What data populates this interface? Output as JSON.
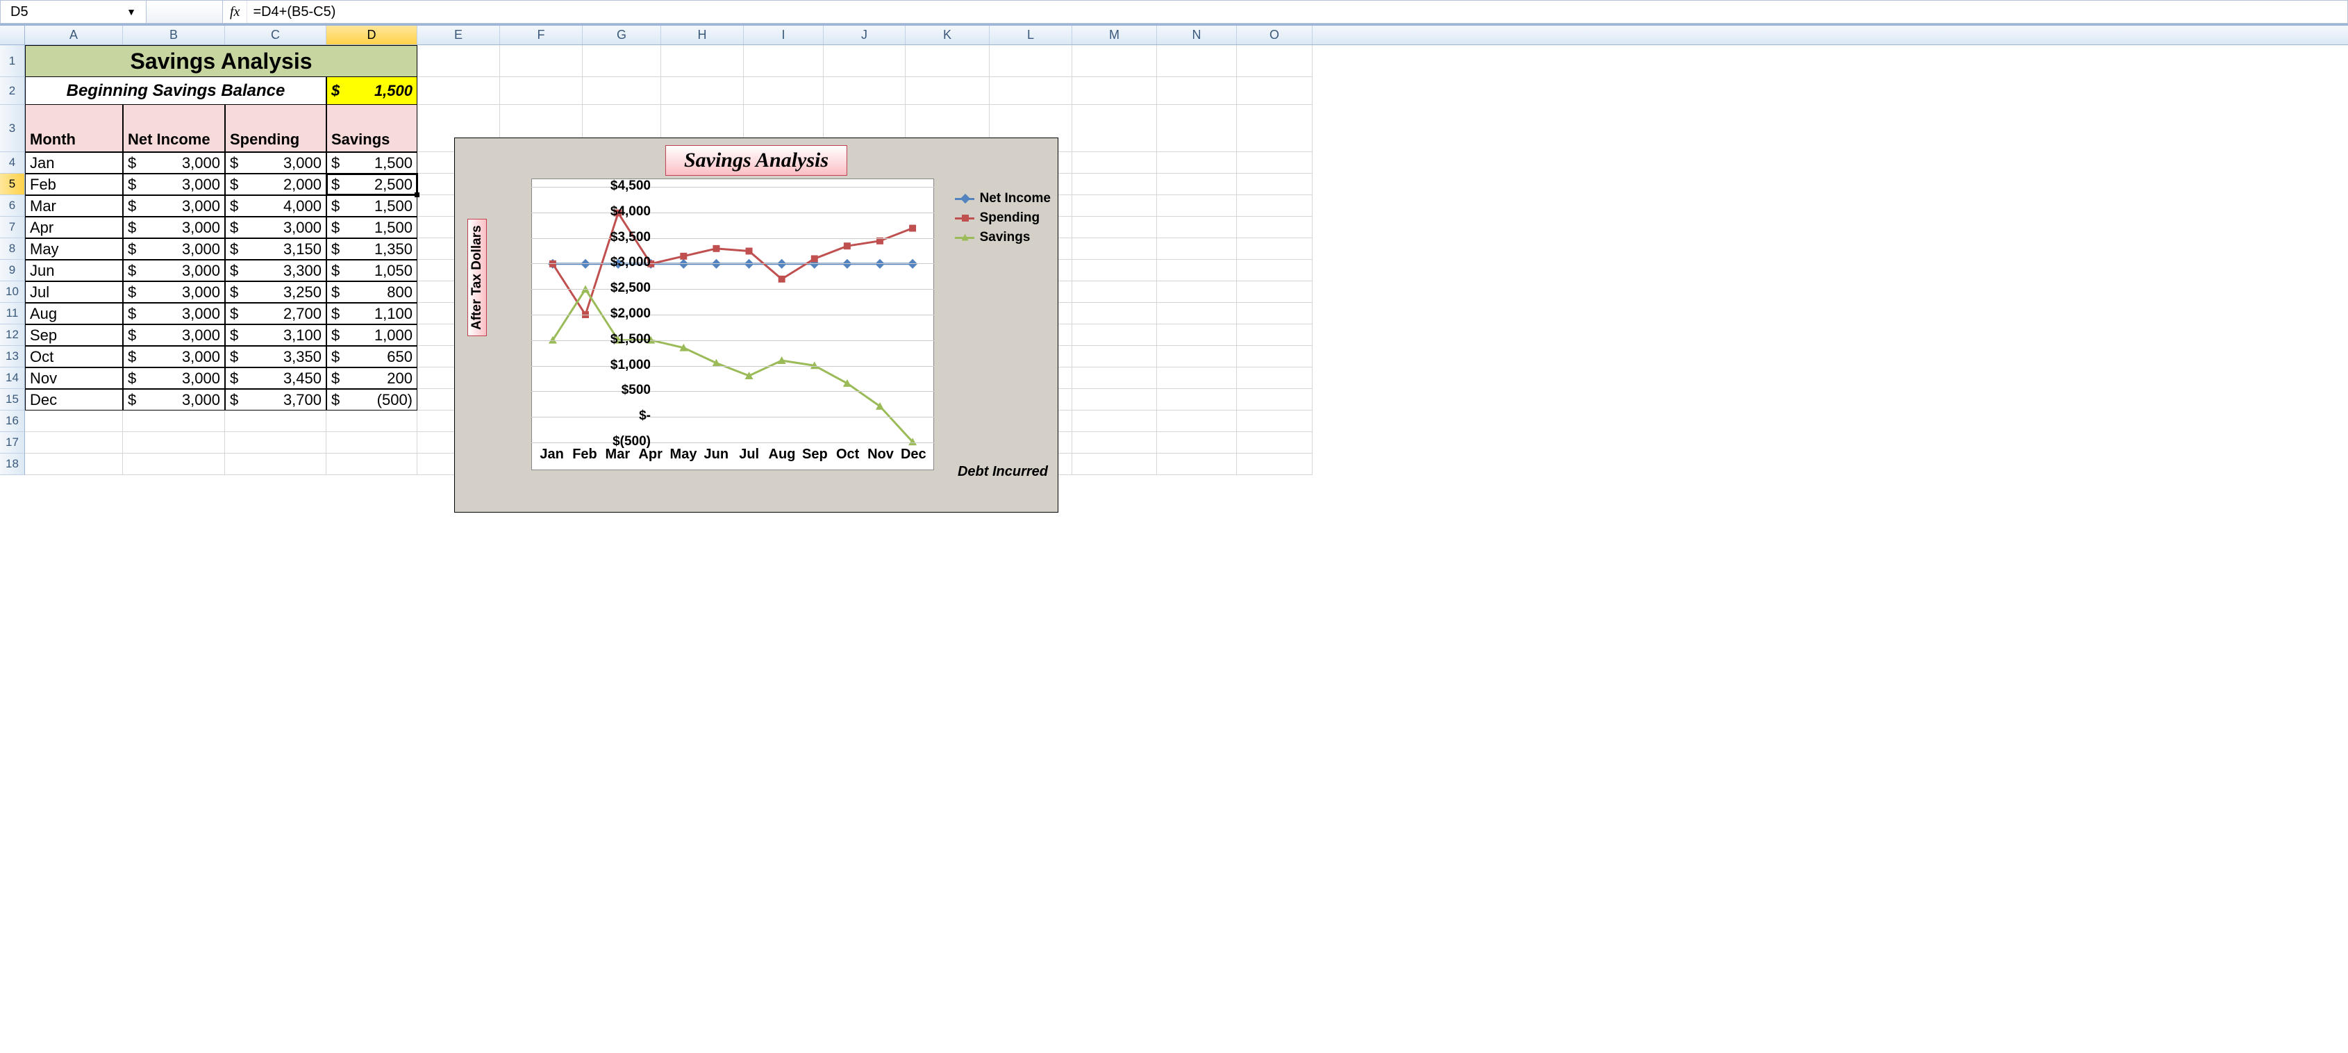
{
  "formula_bar": {
    "cell_ref": "D5",
    "fx_label": "fx",
    "formula": "=D4+(B5-C5)"
  },
  "columns": [
    "A",
    "B",
    "C",
    "D",
    "E",
    "F",
    "G",
    "H",
    "I",
    "J",
    "K",
    "L",
    "M",
    "N",
    "O"
  ],
  "selected_col": "D",
  "selected_row": "5",
  "rows": [
    "1",
    "2",
    "3",
    "4",
    "5",
    "6",
    "7",
    "8",
    "9",
    "10",
    "11",
    "12",
    "13",
    "14",
    "15",
    "16",
    "17",
    "18"
  ],
  "sheet": {
    "title": "Savings Analysis",
    "begin_label": "Beginning Savings Balance",
    "begin_value_sym": "$",
    "begin_value": "1,500",
    "headers": {
      "month": "Month",
      "income": "Net Income",
      "spending": "Spending",
      "savings": "Savings"
    },
    "data": [
      {
        "m": "Jan",
        "inc": "3,000",
        "sp": "3,000",
        "sv": "1,500"
      },
      {
        "m": "Feb",
        "inc": "3,000",
        "sp": "2,000",
        "sv": "2,500"
      },
      {
        "m": "Mar",
        "inc": "3,000",
        "sp": "4,000",
        "sv": "1,500"
      },
      {
        "m": "Apr",
        "inc": "3,000",
        "sp": "3,000",
        "sv": "1,500"
      },
      {
        "m": "May",
        "inc": "3,000",
        "sp": "3,150",
        "sv": "1,350"
      },
      {
        "m": "Jun",
        "inc": "3,000",
        "sp": "3,300",
        "sv": "1,050"
      },
      {
        "m": "Jul",
        "inc": "3,000",
        "sp": "3,250",
        "sv": "800"
      },
      {
        "m": "Aug",
        "inc": "3,000",
        "sp": "2,700",
        "sv": "1,100"
      },
      {
        "m": "Sep",
        "inc": "3,000",
        "sp": "3,100",
        "sv": "1,000"
      },
      {
        "m": "Oct",
        "inc": "3,000",
        "sp": "3,350",
        "sv": "650"
      },
      {
        "m": "Nov",
        "inc": "3,000",
        "sp": "3,450",
        "sv": "200"
      },
      {
        "m": "Dec",
        "inc": "3,000",
        "sp": "3,700",
        "sv": "(500)"
      }
    ]
  },
  "chart": {
    "title": "Savings Analysis",
    "y_title": "After Tax Dollars",
    "y_ticks": [
      "$4,500",
      "$4,000",
      "$3,500",
      "$3,000",
      "$2,500",
      "$2,000",
      "$1,500",
      "$1,000",
      "$500",
      "$-",
      "$(500)"
    ],
    "x_ticks": [
      "Jan",
      "Feb",
      "Mar",
      "Apr",
      "May",
      "Jun",
      "Jul",
      "Aug",
      "Sep",
      "Oct",
      "Nov",
      "Dec"
    ],
    "legend": [
      "Net Income",
      "Spending",
      "Savings"
    ],
    "annotation": "Debt Incurred"
  },
  "chart_data": {
    "type": "line",
    "categories": [
      "Jan",
      "Feb",
      "Mar",
      "Apr",
      "May",
      "Jun",
      "Jul",
      "Aug",
      "Sep",
      "Oct",
      "Nov",
      "Dec"
    ],
    "series": [
      {
        "name": "Net Income",
        "values": [
          3000,
          3000,
          3000,
          3000,
          3000,
          3000,
          3000,
          3000,
          3000,
          3000,
          3000,
          3000
        ]
      },
      {
        "name": "Spending",
        "values": [
          3000,
          2000,
          4000,
          3000,
          3150,
          3300,
          3250,
          2700,
          3100,
          3350,
          3450,
          3700
        ]
      },
      {
        "name": "Savings",
        "values": [
          1500,
          2500,
          1500,
          1500,
          1350,
          1050,
          800,
          1100,
          1000,
          650,
          200,
          -500
        ]
      }
    ],
    "title": "Savings Analysis",
    "xlabel": "",
    "ylabel": "After Tax Dollars",
    "ylim": [
      -500,
      4500
    ]
  }
}
